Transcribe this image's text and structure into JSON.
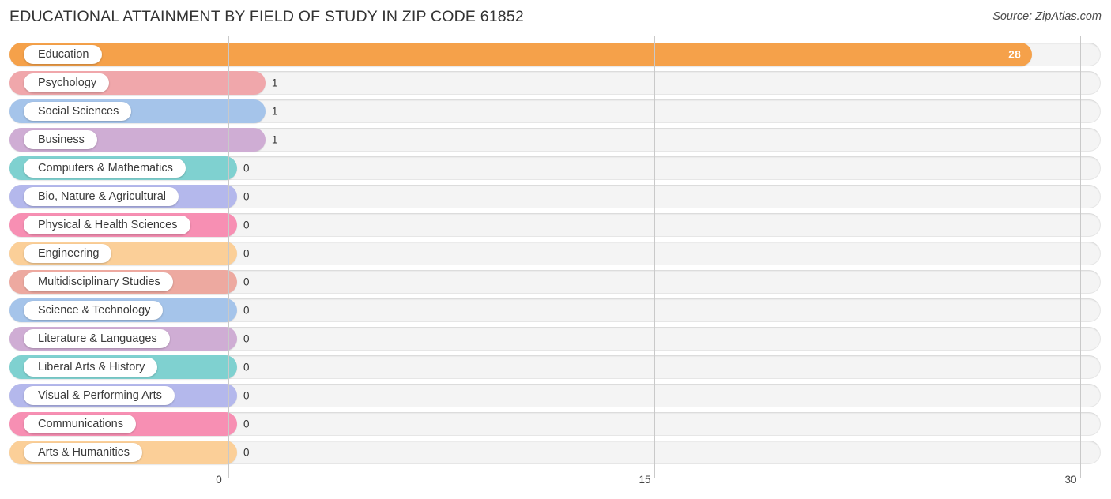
{
  "header": {
    "title": "EDUCATIONAL ATTAINMENT BY FIELD OF STUDY IN ZIP CODE 61852",
    "source": "Source: ZipAtlas.com"
  },
  "chart_data": {
    "type": "bar",
    "orientation": "horizontal",
    "title": "EDUCATIONAL ATTAINMENT BY FIELD OF STUDY IN ZIP CODE 61852",
    "xlabel": "",
    "ylabel": "",
    "xlim": [
      0,
      30
    ],
    "grid": true,
    "legend": "none",
    "ticks": [
      "0",
      "15",
      "30"
    ],
    "tick_values": [
      0,
      15,
      30
    ],
    "categories": [
      "Education",
      "Psychology",
      "Social Sciences",
      "Business",
      "Computers & Mathematics",
      "Bio, Nature & Agricultural",
      "Physical & Health Sciences",
      "Engineering",
      "Multidisciplinary Studies",
      "Science & Technology",
      "Literature & Languages",
      "Liberal Arts & History",
      "Visual & Performing Arts",
      "Communications",
      "Arts & Humanities"
    ],
    "values": [
      28,
      1,
      1,
      1,
      0,
      0,
      0,
      0,
      0,
      0,
      0,
      0,
      0,
      0,
      0
    ],
    "value_labels": [
      "28",
      "1",
      "1",
      "1",
      "0",
      "0",
      "0",
      "0",
      "0",
      "0",
      "0",
      "0",
      "0",
      "0",
      "0"
    ],
    "colors": [
      "#f5a14a",
      "#f0a7ab",
      "#a5c4ea",
      "#cfadd4",
      "#7fd1d0",
      "#b4b8ec",
      "#f78fb3",
      "#fbcf98",
      "#eda9a0",
      "#a5c4ea",
      "#cfadd4",
      "#7fd1d0",
      "#b4b8ec",
      "#f78fb3",
      "#fbcf98"
    ]
  },
  "rows": [
    {
      "label": "Education",
      "value": 28,
      "value_label": "28",
      "color": "#f5a14a",
      "value_inside": true
    },
    {
      "label": "Psychology",
      "value": 1,
      "value_label": "1",
      "color": "#f0a7ab",
      "value_inside": false
    },
    {
      "label": "Social Sciences",
      "value": 1,
      "value_label": "1",
      "color": "#a5c4ea",
      "value_inside": false
    },
    {
      "label": "Business",
      "value": 1,
      "value_label": "1",
      "color": "#cfadd4",
      "value_inside": false
    },
    {
      "label": "Computers & Mathematics",
      "value": 0,
      "value_label": "0",
      "color": "#7fd1d0",
      "value_inside": false
    },
    {
      "label": "Bio, Nature & Agricultural",
      "value": 0,
      "value_label": "0",
      "color": "#b4b8ec",
      "value_inside": false
    },
    {
      "label": "Physical & Health Sciences",
      "value": 0,
      "value_label": "0",
      "color": "#f78fb3",
      "value_inside": false
    },
    {
      "label": "Engineering",
      "value": 0,
      "value_label": "0",
      "color": "#fbcf98",
      "value_inside": false
    },
    {
      "label": "Multidisciplinary Studies",
      "value": 0,
      "value_label": "0",
      "color": "#eda9a0",
      "value_inside": false
    },
    {
      "label": "Science & Technology",
      "value": 0,
      "value_label": "0",
      "color": "#a5c4ea",
      "value_inside": false
    },
    {
      "label": "Literature & Languages",
      "value": 0,
      "value_label": "0",
      "color": "#cfadd4",
      "value_inside": false
    },
    {
      "label": "Liberal Arts & History",
      "value": 0,
      "value_label": "0",
      "color": "#7fd1d0",
      "value_inside": false
    },
    {
      "label": "Visual & Performing Arts",
      "value": 0,
      "value_label": "0",
      "color": "#b4b8ec",
      "value_inside": false
    },
    {
      "label": "Communications",
      "value": 0,
      "value_label": "0",
      "color": "#f78fb3",
      "value_inside": false
    },
    {
      "label": "Arts & Humanities",
      "value": 0,
      "value_label": "0",
      "color": "#fbcf98",
      "value_inside": false
    }
  ],
  "axis": {
    "ticks": [
      {
        "label": "0",
        "value": 0
      },
      {
        "label": "15",
        "value": 15
      },
      {
        "label": "30",
        "value": 30
      }
    ]
  }
}
